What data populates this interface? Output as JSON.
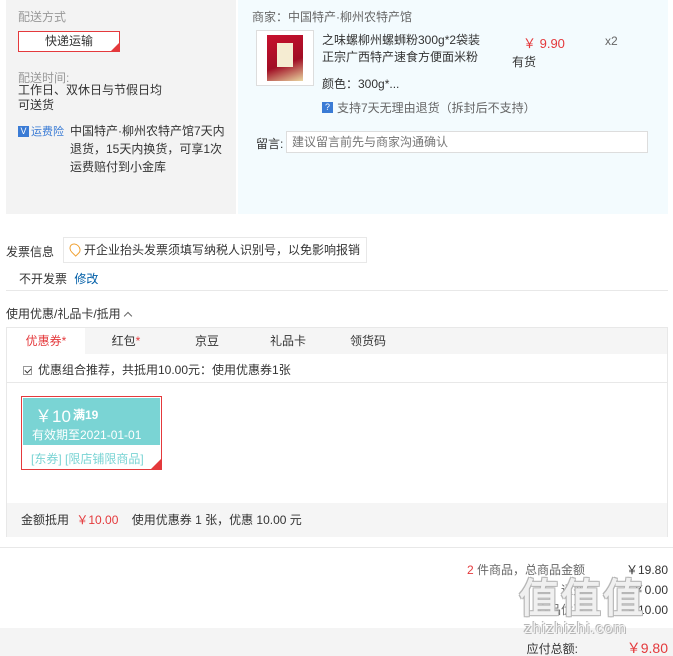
{
  "shipping": {
    "method_label": "配送方式",
    "method_value": "快递运输",
    "time_label": "配送时间:",
    "time_value_line1": "工作日、双休日与节假日均",
    "time_value_line2": "可送货",
    "insurance_badge": "运费险",
    "insurance_text_line1": "中国特产·柳州农特产馆7天内",
    "insurance_text_line2": "退货，15天内换货，可享1次",
    "insurance_text_line3": "运费赔付到小金库"
  },
  "product": {
    "shop": "商家：中国特产·柳州农特产馆",
    "title_line1": "之味螺柳州螺蛳粉300g*2袋装",
    "title_line2": "正宗广西特产速食方便面米粉",
    "price": "￥ 9.90",
    "qty": "x2",
    "stock": "有货",
    "color": "颜色：300g*...",
    "return_policy": "支持7天无理由退货（拆封后不支持）",
    "message_label": "留言:",
    "message_placeholder": "建议留言前先与商家沟通确认"
  },
  "invoice": {
    "title": "发票信息",
    "tip": "开企业抬头发票须填写纳税人识别号，以免影响报销",
    "value": "不开发票",
    "edit": "修改"
  },
  "coupons": {
    "title": "使用优惠/礼品卡/抵用",
    "tabs": [
      {
        "label": "优惠券",
        "star": "*"
      },
      {
        "label": "红包",
        "star": "*"
      },
      {
        "label": "京豆",
        "star": ""
      },
      {
        "label": "礼品卡",
        "star": ""
      },
      {
        "label": "领货码",
        "star": ""
      }
    ],
    "combo": "优惠组合推荐，共抵用10.00元：使用优惠券1张",
    "card": {
      "amount": "￥10",
      "condition": "满19",
      "validity": "有效期至2021-01-01",
      "tags": "[东券] [限店铺限商品]"
    },
    "footer_label": "金额抵用",
    "footer_amount": "￥10.00",
    "footer_detail": "使用优惠券 1 张，优惠 10.00 元"
  },
  "summary": {
    "count": "2",
    "count_suffix": " 件商品，总商品金额",
    "total_goods": "￥19.80",
    "shipping_label": "运费",
    "shipping_value": "￥0.00",
    "discount_label": "商品优惠",
    "discount_value": "-￥10.00",
    "payable_label": "应付总额:",
    "payable_value": "￥9.80"
  },
  "watermark": {
    "chars": "值值值",
    "url": "zhizhizhi.com"
  },
  "colors": {
    "accent": "#e4393c",
    "link": "#005ea7",
    "coupon": "#7ad4d4"
  }
}
